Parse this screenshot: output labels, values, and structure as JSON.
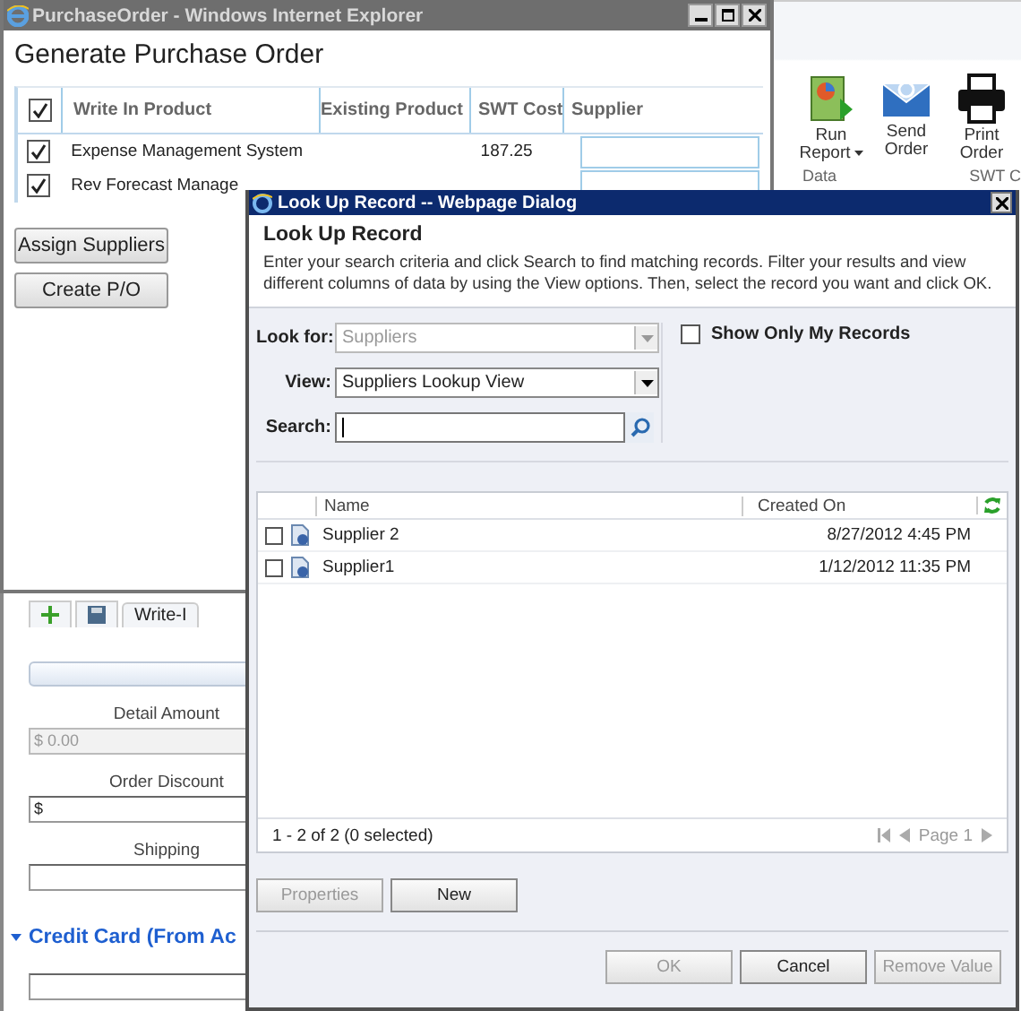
{
  "background_app": {
    "ribbon": {
      "buttons": [
        {
          "label": "Run Report",
          "kind": "report",
          "dropdown": true
        },
        {
          "label": "Send Order",
          "kind": "mail",
          "dropdown": false
        },
        {
          "label": "Print Order",
          "kind": "print",
          "dropdown": false
        }
      ],
      "groups": [
        "Data",
        "SWT C"
      ]
    },
    "form": {
      "tab_label": "Write-I",
      "fields": [
        {
          "label": "Detail Amount",
          "value": "$ 0.00",
          "disabled": true
        },
        {
          "label": "Order Discount",
          "value": "$",
          "disabled": false
        },
        {
          "label": "Shipping",
          "disabled": false
        }
      ],
      "section": {
        "title": "Credit Card (From Ac",
        "expanded": true
      }
    }
  },
  "popup_window": {
    "title": "PurchaseOrder - Windows Internet Explorer",
    "heading": "Generate Purchase Order",
    "table": {
      "header_checked": true,
      "columns": [
        "Write In Product",
        "Existing Product",
        "SWT Cost",
        "Supplier"
      ],
      "rows": [
        {
          "checked": true,
          "write_in_product": "Expense Management System",
          "swt_cost": "187.25"
        },
        {
          "checked": true,
          "write_in_product": "Rev Forecast Manage"
        }
      ]
    },
    "buttons": [
      "Assign Suppliers",
      "Create P/O"
    ]
  },
  "dialog": {
    "title": "Look Up Record -- Webpage Dialog",
    "heading": "Look Up Record",
    "description": "Enter your search criteria and click Search to find matching records. Filter your results and view different columns of data by using the View options. Then, select the record you want and click OK.",
    "look_for": {
      "label": "Look for:",
      "value": "Suppliers",
      "disabled": true
    },
    "view": {
      "label": "View:",
      "value": "Suppliers Lookup View",
      "disabled": false
    },
    "search": {
      "label": "Search:"
    },
    "show_only_my_records": {
      "label": "Show Only My Records",
      "checked": false
    },
    "grid": {
      "columns": [
        "Name",
        "Created On"
      ],
      "rows": [
        {
          "checked": false,
          "name": "Supplier 2",
          "created_on": "8/27/2012 4:45 PM"
        },
        {
          "checked": false,
          "name": "Supplier1",
          "created_on": "1/12/2012 11:35 PM"
        }
      ],
      "status": "1 - 2 of 2 (0 selected)",
      "page": "Page 1"
    },
    "buttons": [
      {
        "label": "Properties",
        "disabled": true
      },
      {
        "label": "New",
        "disabled": false
      }
    ],
    "footer_buttons": [
      {
        "label": "OK",
        "disabled": true
      },
      {
        "label": "Cancel",
        "disabled": false
      },
      {
        "label": "Remove Value",
        "disabled": true
      }
    ]
  }
}
